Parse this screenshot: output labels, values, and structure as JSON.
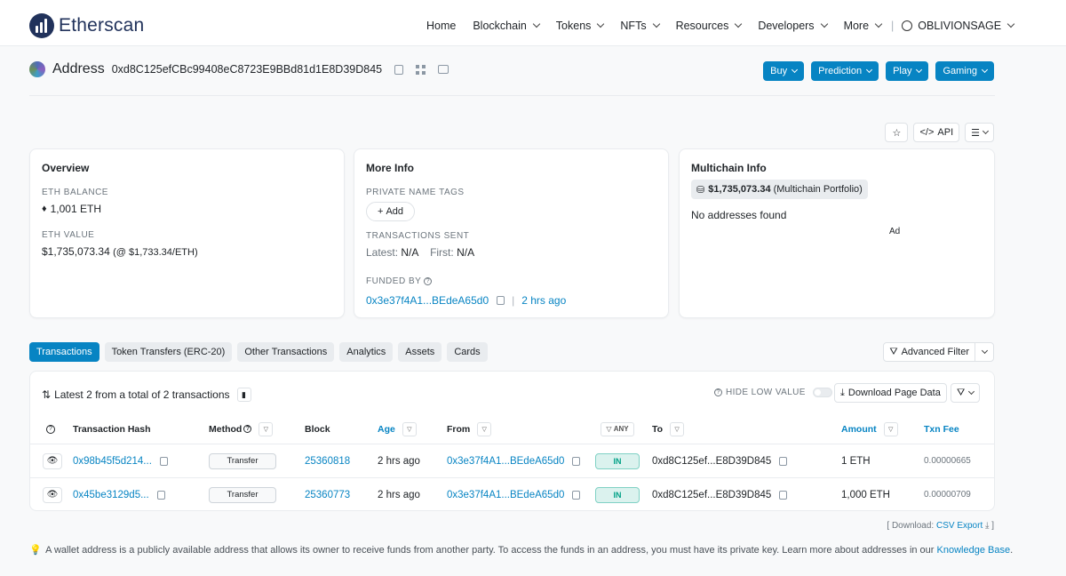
{
  "brand": {
    "name": "Etherscan"
  },
  "nav": {
    "items": [
      "Home",
      "Blockchain",
      "Tokens",
      "NFTs",
      "Resources",
      "Developers",
      "More"
    ],
    "user": "OBLIVIONSAGE"
  },
  "header": {
    "title": "Address",
    "address": "0xd8C125efCBc99408eC8723E9BBd81d1E8D39D845",
    "buttons": [
      "Buy",
      "Prediction",
      "Play",
      "Gaming"
    ]
  },
  "tools": {
    "api": "API"
  },
  "overview": {
    "title": "Overview",
    "eth_balance_label": "ETH BALANCE",
    "eth_balance": "1,001 ETH",
    "eth_value_label": "ETH VALUE",
    "eth_value": "$1,735,073.34",
    "eth_price": "(@ $1,733.34/ETH)"
  },
  "more_info": {
    "title": "More Info",
    "tags_label": "PRIVATE NAME TAGS",
    "add": "Add",
    "tx_sent_label": "TRANSACTIONS SENT",
    "latest_label": "Latest:",
    "latest": "N/A",
    "first_label": "First:",
    "first": "N/A",
    "funded_label": "FUNDED BY",
    "funded_by": "0x3e37f4A1...BEdeA65d0",
    "funded_age": "2 hrs ago"
  },
  "multichain": {
    "title": "Multichain Info",
    "portfolio_value": "$1,735,073.34",
    "portfolio_label": "(Multichain Portfolio)",
    "no_addresses": "No addresses found",
    "ad": "Ad"
  },
  "tabs": [
    "Transactions",
    "Token Transfers (ERC-20)",
    "Other Transactions",
    "Analytics",
    "Assets",
    "Cards"
  ],
  "advanced_filter": "Advanced Filter",
  "table": {
    "summary": "Latest 2 from a total of 2 transactions",
    "hide_low_value": "HIDE LOW VALUE",
    "download": "Download Page Data",
    "headers": {
      "hash": "Transaction Hash",
      "method": "Method",
      "block": "Block",
      "age": "Age",
      "from": "From",
      "any": "ANY",
      "to": "To",
      "amount": "Amount",
      "fee": "Txn Fee"
    },
    "rows": [
      {
        "hash": "0x98b45f5d214...",
        "method": "Transfer",
        "block": "25360818",
        "age": "2 hrs ago",
        "from": "0x3e37f4A1...BEdeA65d0",
        "dir": "IN",
        "to": "0xd8C125ef...E8D39D845",
        "amount": "1 ETH",
        "fee": "0.00000665"
      },
      {
        "hash": "0x45be3129d5...",
        "method": "Transfer",
        "block": "25360773",
        "age": "2 hrs ago",
        "from": "0x3e37f4A1...BEdeA65d0",
        "dir": "IN",
        "to": "0xd8C125ef...E8D39D845",
        "amount": "1,000 ETH",
        "fee": "0.00000709"
      }
    ]
  },
  "csv": {
    "prefix": "[ Download:",
    "link": "CSV Export",
    "suffix": "]"
  },
  "footer": {
    "text": "A wallet address is a publicly available address that allows its owner to receive funds from another party. To access the funds in an address, you must have its private key. Learn more about addresses in our",
    "link": "Knowledge Base",
    "end": "."
  }
}
